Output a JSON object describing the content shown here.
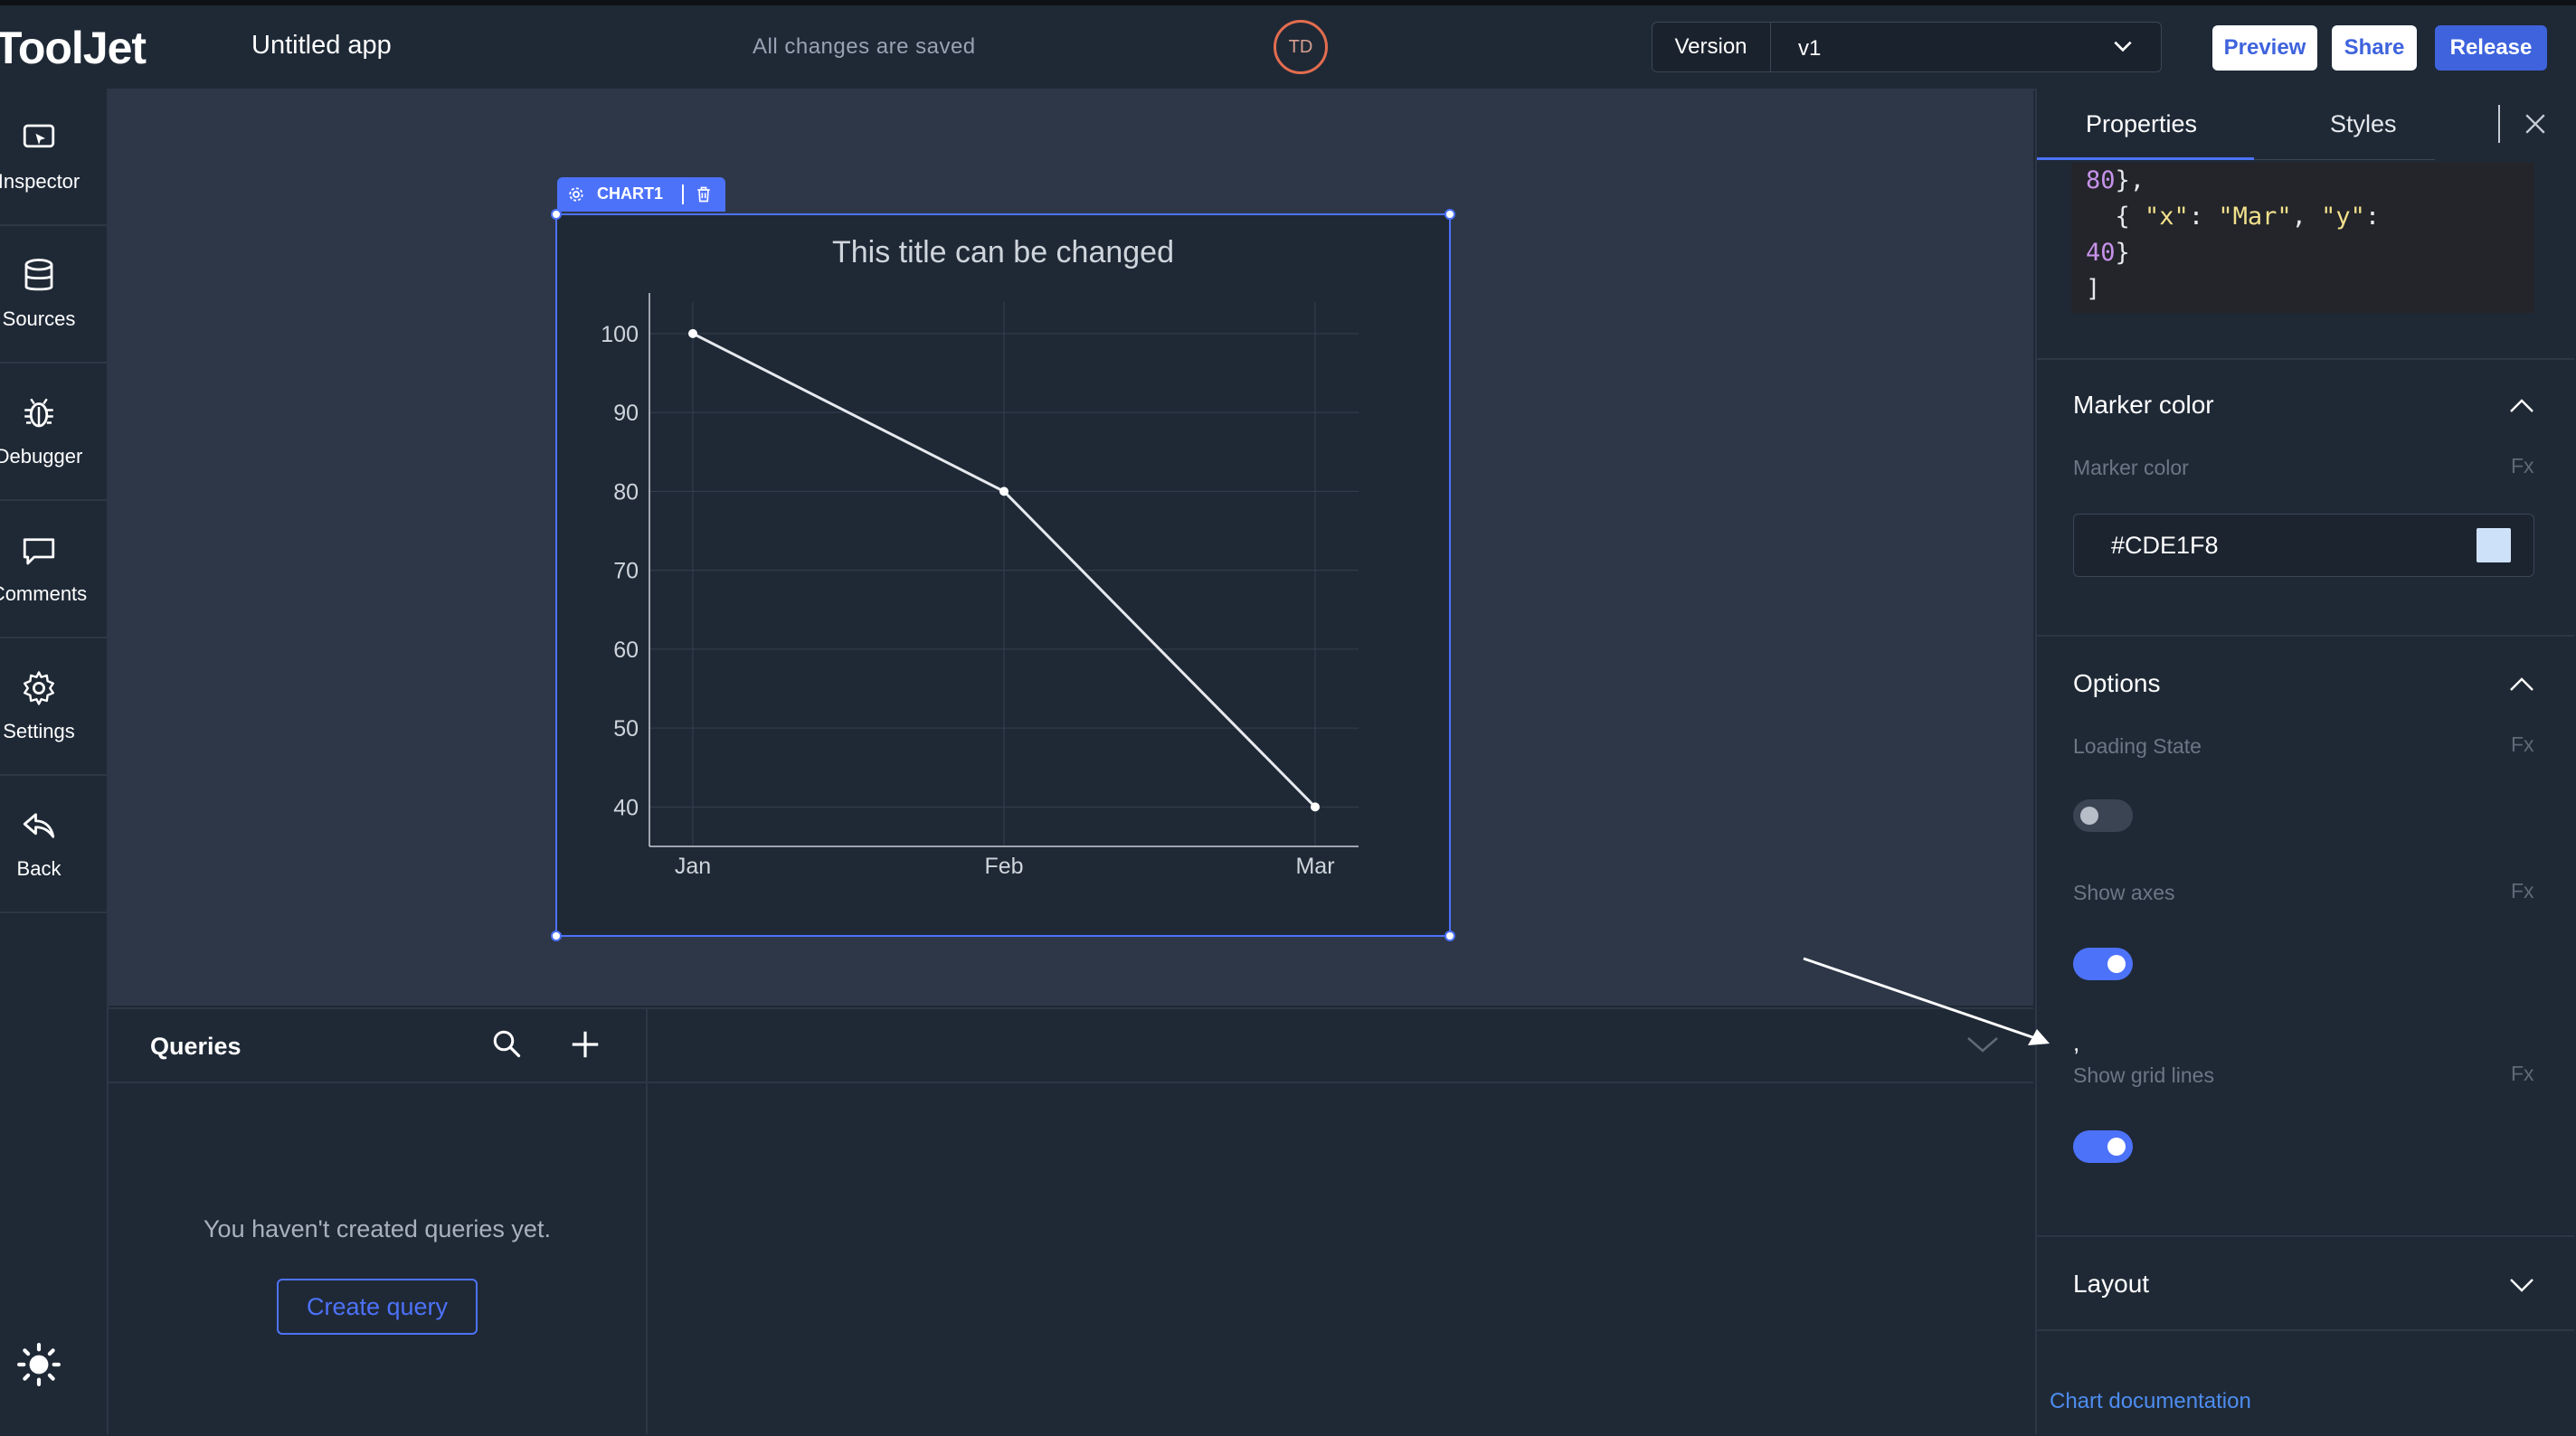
{
  "header": {
    "logo": "ToolJet",
    "app_name": "Untitled app",
    "save_status": "All changes are saved",
    "avatar_initials": "TD",
    "version_label": "Version",
    "version_value": "v1",
    "preview_label": "Preview",
    "share_label": "Share",
    "release_label": "Release"
  },
  "sidebar": {
    "items": [
      {
        "label": "Inspector",
        "icon": "inspector-icon"
      },
      {
        "label": "Sources",
        "icon": "database-icon"
      },
      {
        "label": "Debugger",
        "icon": "bug-icon"
      },
      {
        "label": "Comments",
        "icon": "comment-icon"
      },
      {
        "label": "Settings",
        "icon": "gear-icon"
      },
      {
        "label": "Back",
        "icon": "back-arrow-icon"
      }
    ],
    "theme_icon": "sun-icon"
  },
  "widget": {
    "tag": "CHART1"
  },
  "chart_data": {
    "type": "line",
    "title": "This title can be changed",
    "categories": [
      "Jan",
      "Feb",
      "Mar"
    ],
    "values": [
      100,
      80,
      40
    ],
    "yticks": [
      40,
      50,
      60,
      70,
      80,
      90,
      100
    ],
    "ylim": [
      35,
      104
    ],
    "grid": true,
    "line_color": "#e6e9ee",
    "marker_color": "#CDE1F8"
  },
  "queries": {
    "title": "Queries",
    "empty_text": "You haven't created queries yet.",
    "create_label": "Create query"
  },
  "properties": {
    "tab_properties": "Properties",
    "tab_styles": "Styles",
    "code_lines": [
      "80},",
      "  { \"x\": \"Mar\", \"y\":",
      "40}",
      "]"
    ],
    "marker_section": "Marker color",
    "marker_label": "Marker color",
    "marker_value": "#CDE1F8",
    "options_section": "Options",
    "loading_label": "Loading State",
    "loading_on": false,
    "axes_label": "Show axes",
    "axes_on": true,
    "grid_label": "Show grid lines",
    "grid_on": true,
    "fx": "Fx",
    "stray_mark": ",",
    "layout_section": "Layout",
    "doc_link": "Chart documentation"
  },
  "colors": {
    "accent": "#4d72fa",
    "background": "#1f2936",
    "canvas": "#2d3748"
  }
}
